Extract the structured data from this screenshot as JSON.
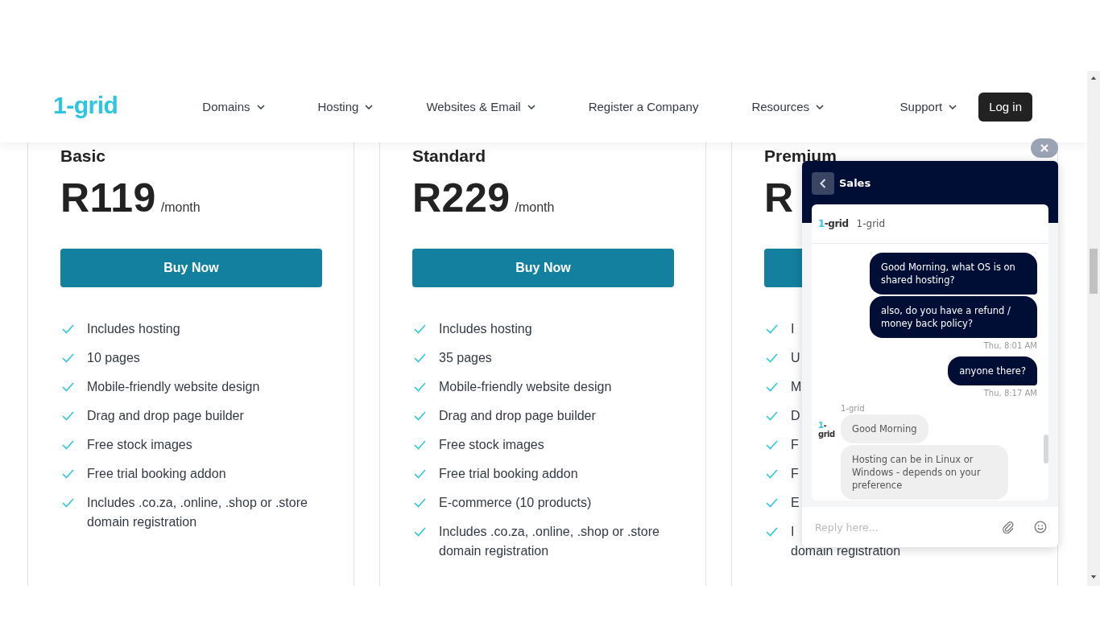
{
  "header": {
    "logo": "1-grid",
    "nav": [
      {
        "label": "Domains",
        "dropdown": true
      },
      {
        "label": "Hosting",
        "dropdown": true
      },
      {
        "label": "Websites & Email",
        "dropdown": true
      },
      {
        "label": "Register a Company",
        "dropdown": false
      },
      {
        "label": "Resources",
        "dropdown": true
      }
    ],
    "support": {
      "label": "Support",
      "dropdown": true
    },
    "login": "Log in"
  },
  "plans": [
    {
      "name": "Basic",
      "price": "R119",
      "period": "/month",
      "button": "Buy Now",
      "features": [
        "Includes hosting",
        "10 pages",
        "Mobile-friendly website design",
        "Drag and drop page builder",
        "Free stock images",
        "Free trial booking addon",
        "Includes .co.za, .online, .shop or .store domain registration"
      ]
    },
    {
      "name": "Standard",
      "price": "R229",
      "period": "/month",
      "button": "Buy Now",
      "features": [
        "Includes hosting",
        "35 pages",
        "Mobile-friendly website design",
        "Drag and drop page builder",
        "Free stock images",
        "Free trial booking addon",
        "E-commerce (10 products)",
        "Includes .co.za, .online, .shop or .store domain registration"
      ]
    },
    {
      "name": "Premium",
      "price": "R",
      "features": [
        "I",
        "U",
        "M",
        "D",
        "F",
        "F",
        "E",
        "I"
      ],
      "features_tail": "domain registration"
    }
  ],
  "chat": {
    "title": "Sales",
    "brand": {
      "accent": "1",
      "rest": "-grid"
    },
    "agent": "1-grid",
    "messages": [
      {
        "kind": "outgoing",
        "text": "Good Morning, what OS is on shared hosting?"
      },
      {
        "kind": "outgoing",
        "text": "also, do you have a refund / money back policy?"
      },
      {
        "kind": "timestamp",
        "text": "Thu, 8:01 AM"
      },
      {
        "kind": "outgoing",
        "text": "anyone there?"
      },
      {
        "kind": "timestamp",
        "text": "Thu, 8:17 AM"
      },
      {
        "kind": "sender",
        "text": "1-grid"
      },
      {
        "kind": "incoming",
        "text": "Good Morning",
        "avatar": {
          "accent": "1",
          "rest": "-grid"
        }
      },
      {
        "kind": "incoming",
        "text": "Hosting can be in Linux or Windows - depends on your preference"
      }
    ],
    "input": {
      "placeholder": "Reply here..."
    }
  }
}
